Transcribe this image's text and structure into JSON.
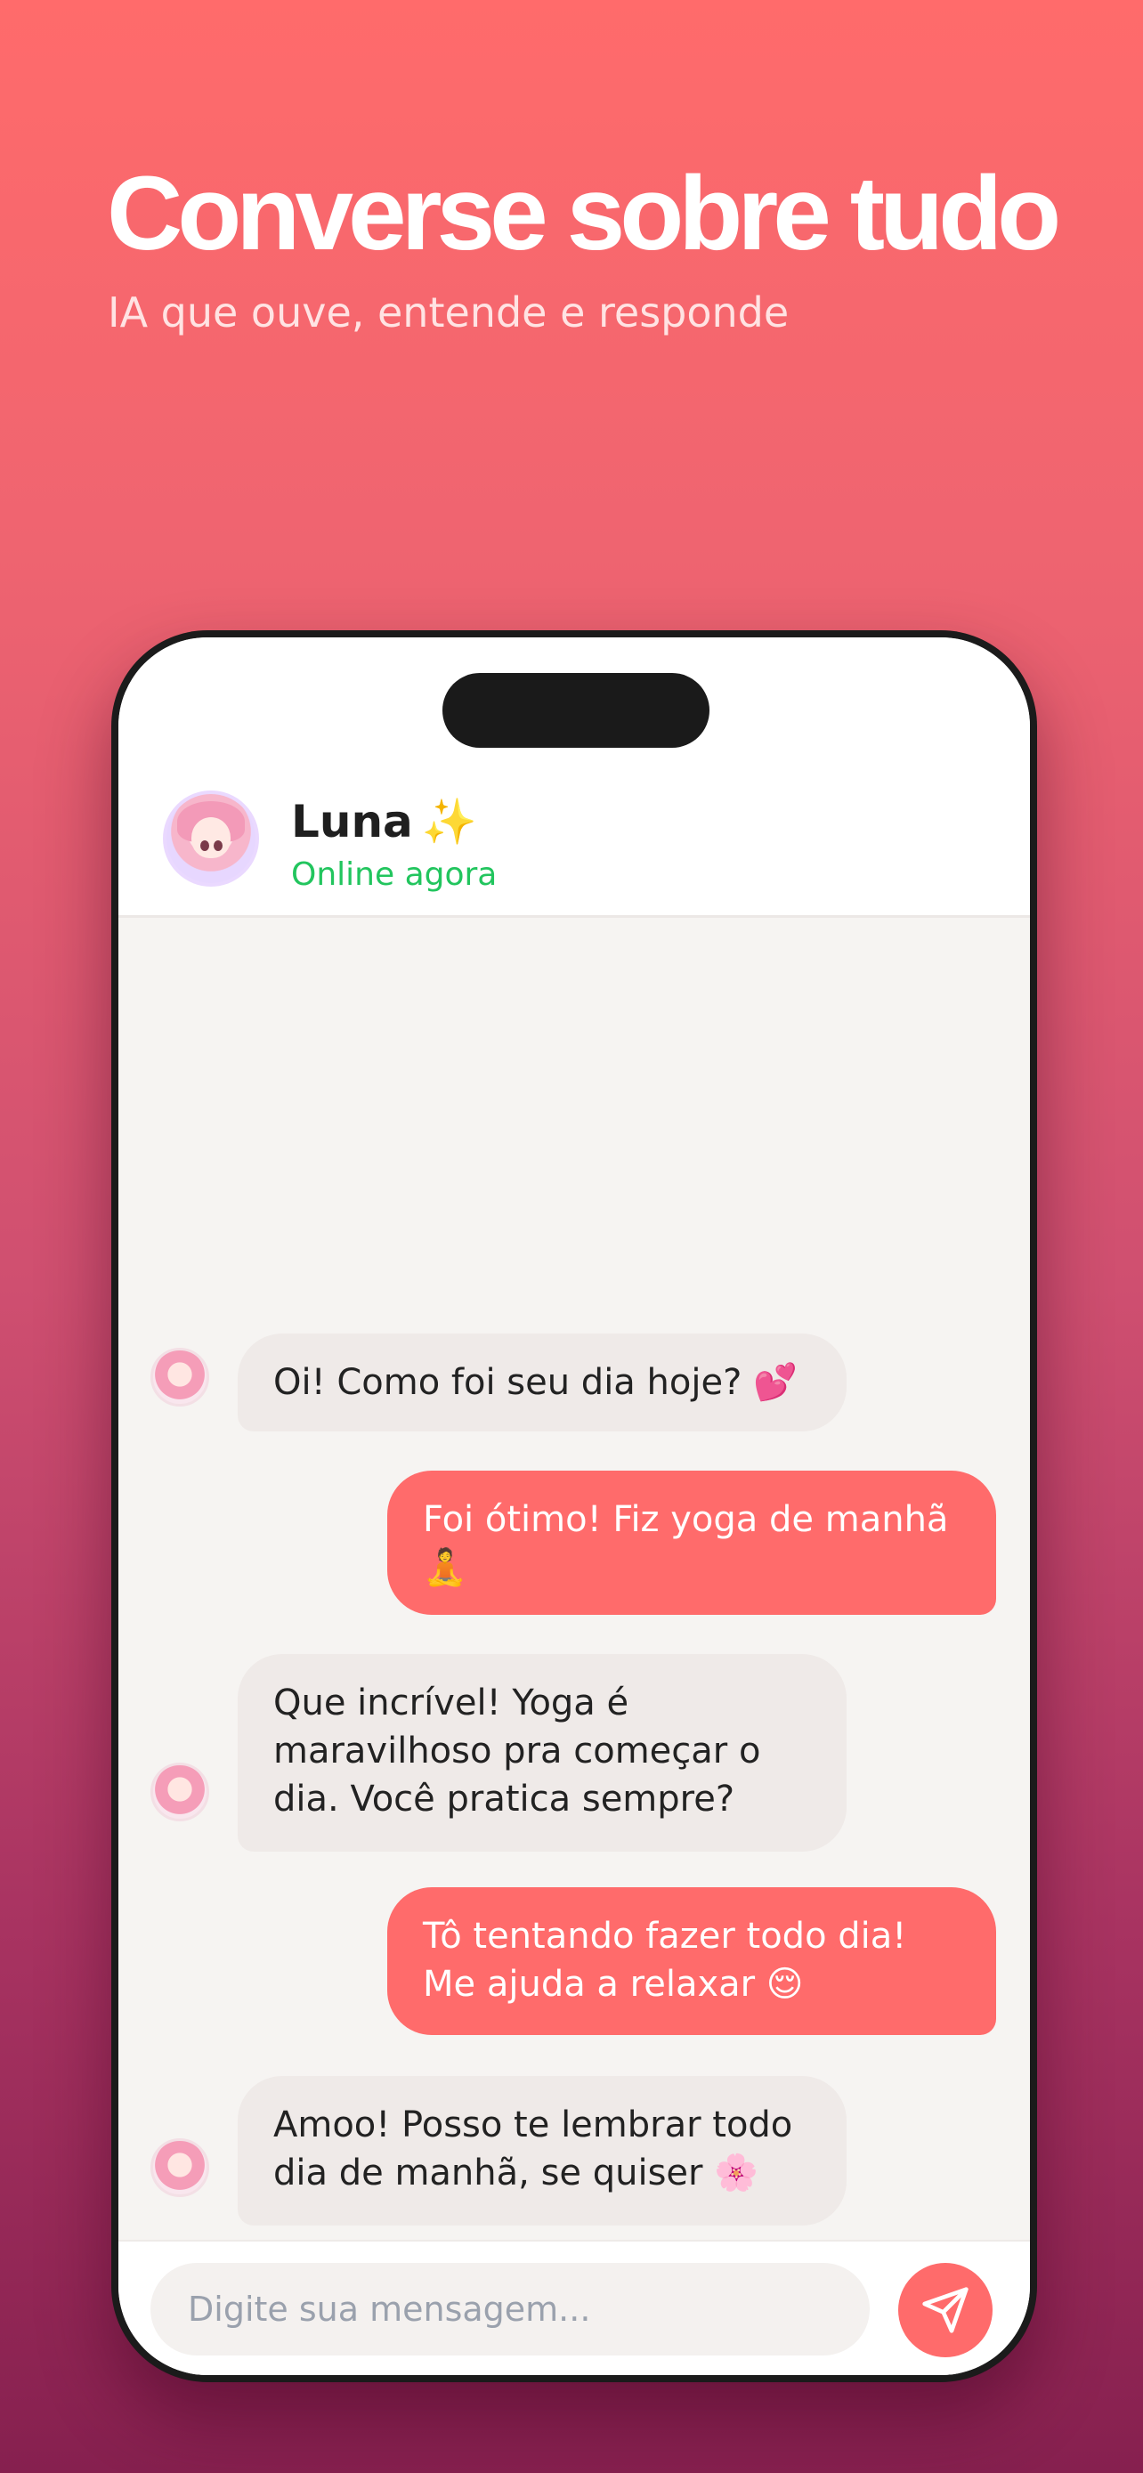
{
  "hero": {
    "title": "Converse sobre tudo",
    "subtitle": "IA que ouve, entende e responde"
  },
  "chat": {
    "contact": {
      "name": "Luna",
      "name_emoji": "✨",
      "status": "Online agora",
      "status_color": "#22c55e"
    },
    "messages": [
      {
        "from": "bot",
        "text": "Oi! Como foi seu dia hoje? 💕"
      },
      {
        "from": "user",
        "text": "Foi ótimo! Fiz yoga de manhã\n🧘"
      },
      {
        "from": "bot",
        "text": "Que incrível! Yoga é\nmaravilhoso pra começar o\ndia. Você pratica sempre?"
      },
      {
        "from": "user",
        "text": "Tô tentando fazer todo dia!\nMe ajuda a relaxar 😌"
      },
      {
        "from": "bot",
        "text": "Amoo! Posso te lembrar todo\ndia de manhã, se quiser 🌸"
      }
    ],
    "input": {
      "placeholder": "Digite sua mensagem...",
      "value": ""
    },
    "send_icon": "send-icon"
  },
  "colors": {
    "accent": "#ff6b6b",
    "bot_bubble": "#efeae8",
    "online": "#22c55e"
  }
}
